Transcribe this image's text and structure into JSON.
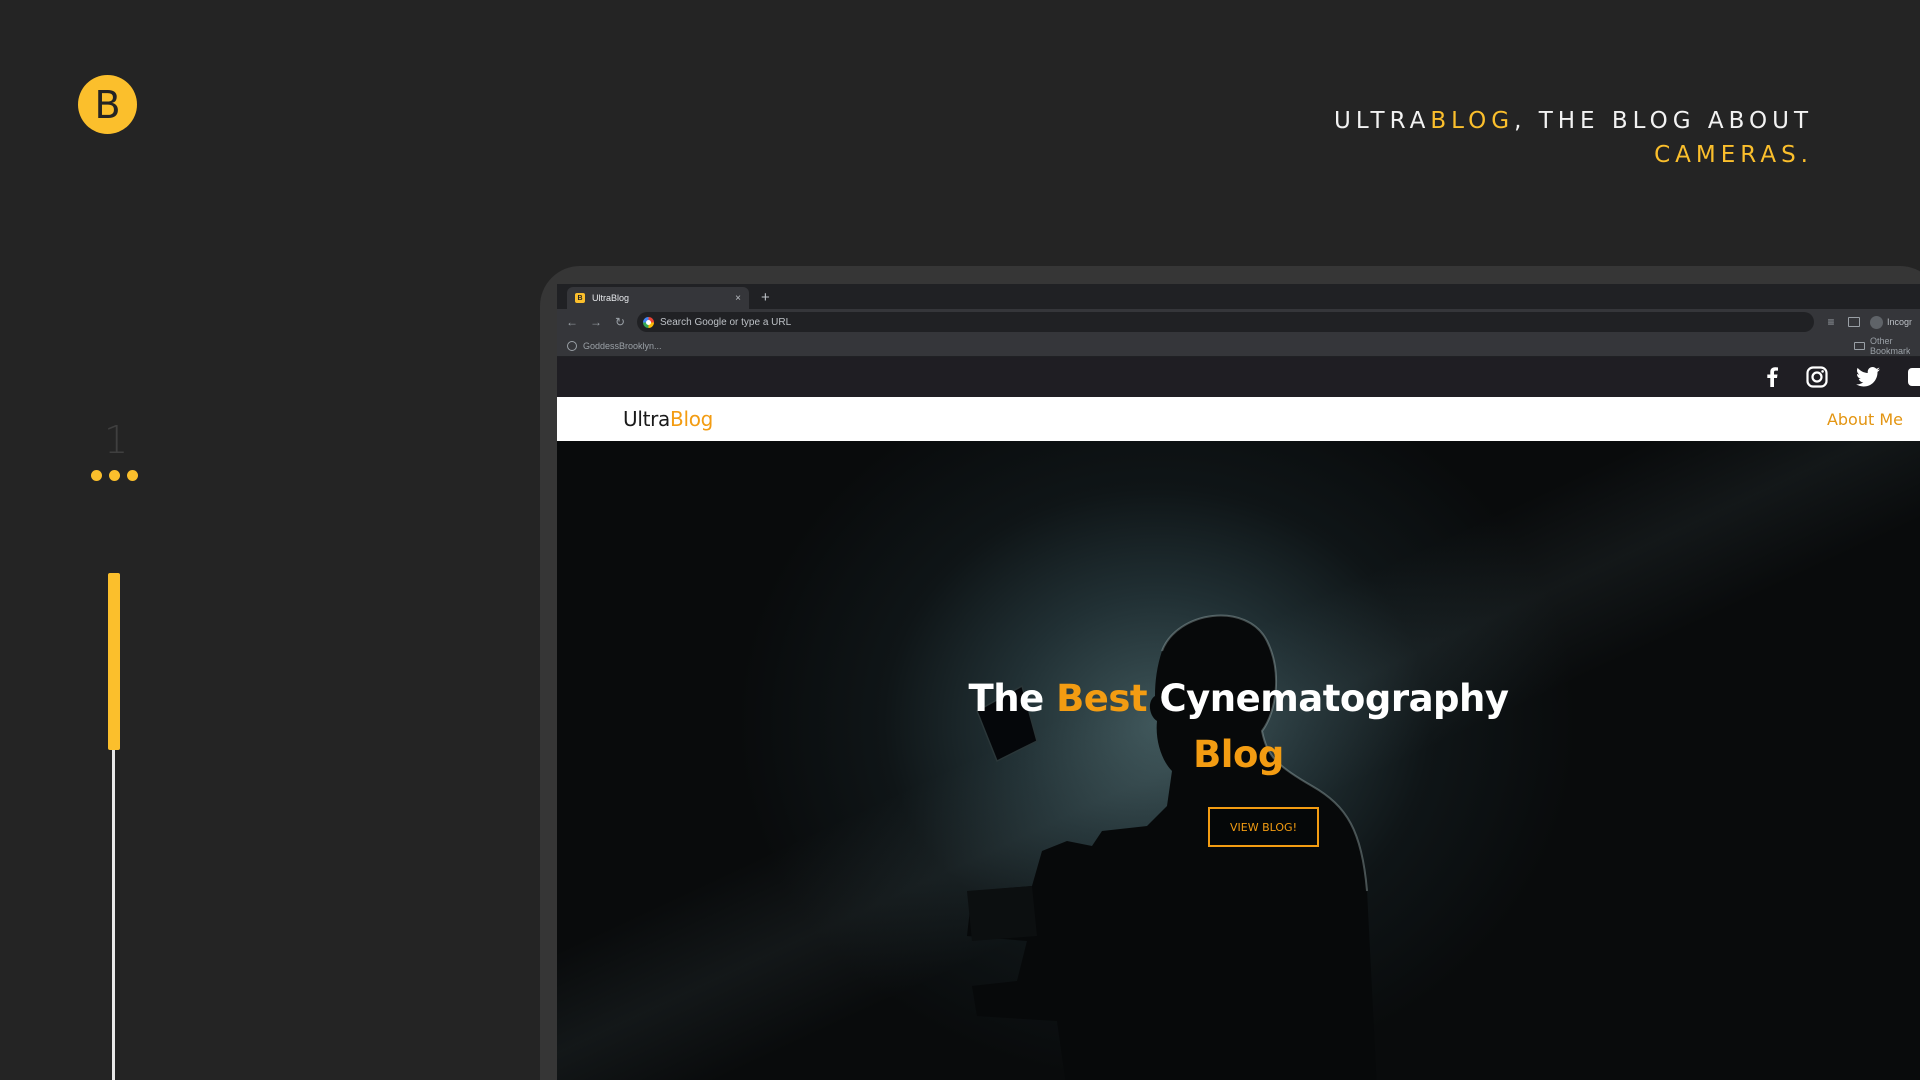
{
  "badge": {
    "letter": "B"
  },
  "headline": {
    "part1": "ULTRA",
    "part2": "BLOG",
    "part3": ", THE BLOG ABOUT",
    "part4": "CAMERAS."
  },
  "slide": {
    "number": "1",
    "progress_fraction": 0.35
  },
  "colors": {
    "accent": "#fbbf2c",
    "site_accent": "#f39c12",
    "background": "#242424"
  },
  "browser": {
    "tab_title": "UltraBlog",
    "tab_favicon": "B",
    "tab_close": "×",
    "new_tab": "+",
    "omnibox_placeholder": "Search Google or type a URL",
    "profile_label": "Incognito",
    "bookmark_1": "GoddessBrooklyn...",
    "bookmark_other": "Other Bookmarks",
    "icons": [
      "back-icon",
      "forward-icon",
      "reload-icon",
      "google-icon",
      "reading-list-icon",
      "side-panel-icon",
      "profile-icon",
      "globe-icon",
      "folder-icon"
    ]
  },
  "site": {
    "social_icons": [
      "facebook-icon",
      "instagram-icon",
      "twitter-icon",
      "youtube-icon"
    ],
    "brand_part1": "Ultra",
    "brand_part2": "Blog",
    "nav_about": "About Me",
    "hero_word1": "The",
    "hero_word2": "Best",
    "hero_word3": "Cynematography",
    "hero_word4": "Blog",
    "cta_label": "VIEW BLOG!"
  }
}
